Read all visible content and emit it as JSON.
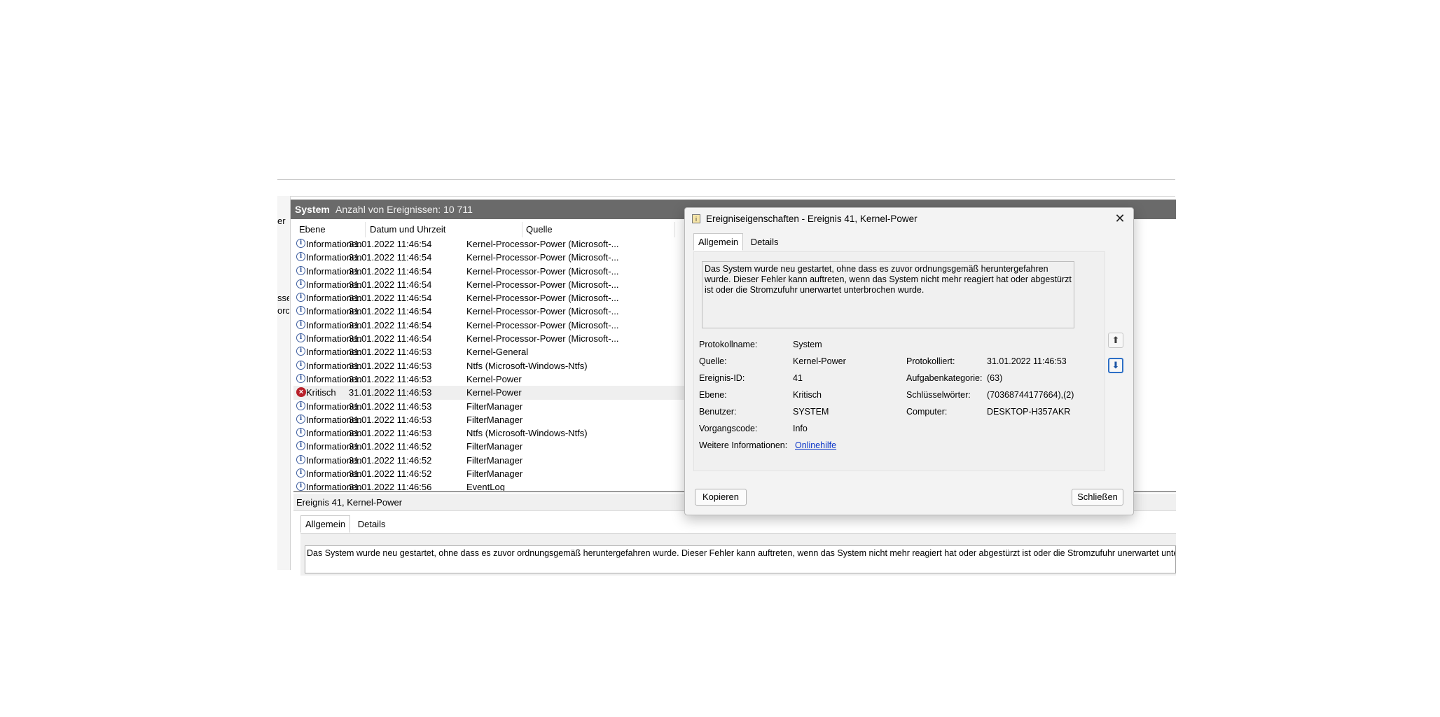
{
  "left_fragments": [
    "er",
    "sse",
    "orc"
  ],
  "main": {
    "title": "System",
    "event_count": "Anzahl von Ereignissen: 10 711",
    "columns": [
      "Ebene",
      "Datum und Uhrzeit",
      "Quelle"
    ],
    "rows": [
      {
        "level": "Informationen",
        "icon": "info-icon",
        "datetime": "31.01.2022 11:46:54",
        "source": "Kernel-Processor-Power (Microsoft-..."
      },
      {
        "level": "Informationen",
        "icon": "info-icon",
        "datetime": "31.01.2022 11:46:54",
        "source": "Kernel-Processor-Power (Microsoft-..."
      },
      {
        "level": "Informationen",
        "icon": "info-icon",
        "datetime": "31.01.2022 11:46:54",
        "source": "Kernel-Processor-Power (Microsoft-..."
      },
      {
        "level": "Informationen",
        "icon": "info-icon",
        "datetime": "31.01.2022 11:46:54",
        "source": "Kernel-Processor-Power (Microsoft-..."
      },
      {
        "level": "Informationen",
        "icon": "info-icon",
        "datetime": "31.01.2022 11:46:54",
        "source": "Kernel-Processor-Power (Microsoft-..."
      },
      {
        "level": "Informationen",
        "icon": "info-icon",
        "datetime": "31.01.2022 11:46:54",
        "source": "Kernel-Processor-Power (Microsoft-..."
      },
      {
        "level": "Informationen",
        "icon": "info-icon",
        "datetime": "31.01.2022 11:46:54",
        "source": "Kernel-Processor-Power (Microsoft-..."
      },
      {
        "level": "Informationen",
        "icon": "info-icon",
        "datetime": "31.01.2022 11:46:54",
        "source": "Kernel-Processor-Power (Microsoft-..."
      },
      {
        "level": "Informationen",
        "icon": "info-icon",
        "datetime": "31.01.2022 11:46:53",
        "source": "Kernel-General"
      },
      {
        "level": "Informationen",
        "icon": "info-icon",
        "datetime": "31.01.2022 11:46:53",
        "source": "Ntfs (Microsoft-Windows-Ntfs)"
      },
      {
        "level": "Informationen",
        "icon": "info-icon",
        "datetime": "31.01.2022 11:46:53",
        "source": "Kernel-Power"
      },
      {
        "level": "Kritisch",
        "icon": "critical-icon",
        "datetime": "31.01.2022 11:46:53",
        "source": "Kernel-Power",
        "selected": true
      },
      {
        "level": "Informationen",
        "icon": "info-icon",
        "datetime": "31.01.2022 11:46:53",
        "source": "FilterManager"
      },
      {
        "level": "Informationen",
        "icon": "info-icon",
        "datetime": "31.01.2022 11:46:53",
        "source": "FilterManager"
      },
      {
        "level": "Informationen",
        "icon": "info-icon",
        "datetime": "31.01.2022 11:46:53",
        "source": "Ntfs (Microsoft-Windows-Ntfs)"
      },
      {
        "level": "Informationen",
        "icon": "info-icon",
        "datetime": "31.01.2022 11:46:52",
        "source": "FilterManager"
      },
      {
        "level": "Informationen",
        "icon": "info-icon",
        "datetime": "31.01.2022 11:46:52",
        "source": "FilterManager"
      },
      {
        "level": "Informationen",
        "icon": "info-icon",
        "datetime": "31.01.2022 11:46:52",
        "source": "FilterManager"
      },
      {
        "level": "Informationen",
        "icon": "info-icon",
        "datetime": "31.01.2022 11:46:56",
        "source": "EventLog"
      }
    ],
    "lower_header": "Ereignis 41, Kernel-Power",
    "lower_tabs": [
      "Allgemein",
      "Details"
    ],
    "lower_text": "Das System wurde neu gestartet, ohne dass es zuvor ordnungsgemäß heruntergefahren wurde. Dieser Fehler kann auftreten, wenn das System nicht mehr reagiert hat oder abgestürzt ist oder die Stromzufuhr unerwartet unterbrochen"
  },
  "dialog": {
    "title": "Ereigniseigenschaften - Ereignis 41, Kernel-Power",
    "tabs": [
      "Allgemein",
      "Details"
    ],
    "description": "Das System wurde neu gestartet, ohne dass es zuvor ordnungsgemäß heruntergefahren wurde. Dieser Fehler kann auftreten, wenn das System nicht mehr reagiert hat oder abgestürzt ist oder die Stromzufuhr unerwartet unterbrochen wurde.",
    "props": {
      "log_name_label": "Protokollname:",
      "log_name": "System",
      "source_label": "Quelle:",
      "source": "Kernel-Power",
      "logged_label": "Protokolliert:",
      "logged": "31.01.2022 11:46:53",
      "event_id_label": "Ereignis-ID:",
      "event_id": "41",
      "task_label": "Aufgabenkategorie:",
      "task": "(63)",
      "level_label": "Ebene:",
      "level": "Kritisch",
      "keywords_label": "Schlüsselwörter:",
      "keywords": "(70368744177664),(2)",
      "user_label": "Benutzer:",
      "user": "SYSTEM",
      "computer_label": "Computer:",
      "computer": "DESKTOP-H357AKR",
      "opcode_label": "Vorgangscode:",
      "opcode": "Info",
      "more_info_label": "Weitere Informationen:",
      "more_info_link": "Onlinehilfe"
    },
    "copy_button": "Kopieren",
    "close_button": "Schließen",
    "close_glyph": "✕",
    "up_glyph": "⬆",
    "down_glyph": "⬇"
  }
}
